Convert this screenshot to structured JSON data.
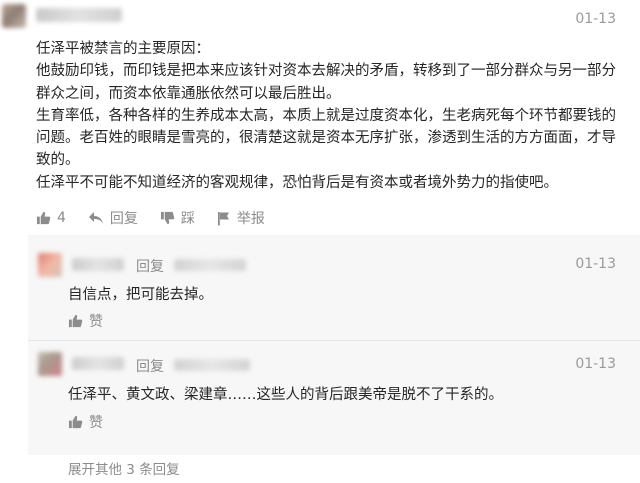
{
  "main_comment": {
    "date": "01-13",
    "paragraphs": [
      "任泽平被禁言的主要原因：",
      "他鼓励印钱，而印钱是把本来应该针对资本去解决的矛盾，转移到了一部分群众与另一部分群众之间，而资本依靠通胀依然可以最后胜出。",
      "生育率低，各种各样的生养成本太高，本质上就是过度资本化，生老病死每个环节都要钱的问题。老百姓的眼睛是雪亮的，很清楚这就是资本无序扩张，渗透到生活的方方面面，才导致的。",
      "任泽平不可能不知道经济的客观规律，恐怕背后是有资本或者境外势力的指使吧。"
    ],
    "like_count": "4",
    "reply_label": "回复",
    "dislike_label": "踩",
    "report_label": "举报",
    "icons": [
      "thumbs-up-icon",
      "reply-arrow-icon",
      "thumbs-down-icon",
      "flag-icon"
    ]
  },
  "replies": [
    {
      "reply_label": "回复",
      "date": "01-13",
      "text": "自信点，把可能去掉。",
      "like_label": "赞"
    },
    {
      "reply_label": "回复",
      "date": "01-13",
      "text": "任泽平、黄文政、梁建章……这些人的背后跟美帝是脱不了干系的。",
      "like_label": "赞"
    }
  ],
  "expand_link": "展开其他 3 条回复",
  "colors": {
    "muted_text": "#8c8c8c",
    "body_text": "#262626",
    "reply_panel_bg": "#f7f7f7"
  }
}
